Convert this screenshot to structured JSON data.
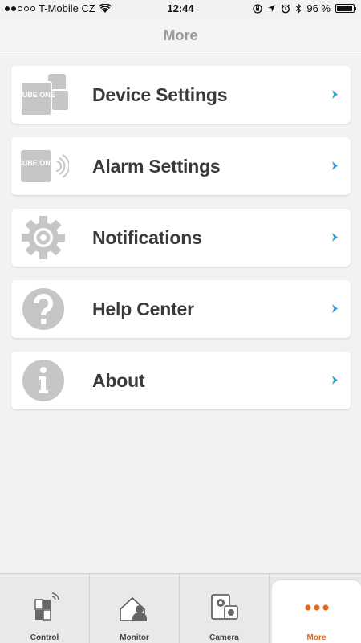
{
  "status_bar": {
    "carrier": "T-Mobile CZ",
    "time": "12:44",
    "battery": "96 %",
    "battery_level": 0.96,
    "signal_bars": 2
  },
  "nav": {
    "title": "More"
  },
  "menu": {
    "items": [
      {
        "label": "Device Settings",
        "icon": "cube-one-devices-icon"
      },
      {
        "label": "Alarm Settings",
        "icon": "cube-one-alarm-icon"
      },
      {
        "label": "Notifications",
        "icon": "gear-icon"
      },
      {
        "label": "Help Center",
        "icon": "question-icon"
      },
      {
        "label": "About",
        "icon": "info-icon"
      }
    ],
    "icon_text": "CUBE ONE"
  },
  "tabbar": {
    "tabs": [
      {
        "label": "Control",
        "icon": "control-icon"
      },
      {
        "label": "Monitor",
        "icon": "monitor-icon"
      },
      {
        "label": "Camera",
        "icon": "camera-icon"
      },
      {
        "label": "More",
        "icon": "more-dots-icon",
        "active": true
      }
    ]
  },
  "colors": {
    "accent": "#e06a1b",
    "chevron": "#3a9fd6",
    "icon_gray": "#c6c6c6",
    "title_gray": "#999999",
    "background": "#f2f2f2"
  }
}
